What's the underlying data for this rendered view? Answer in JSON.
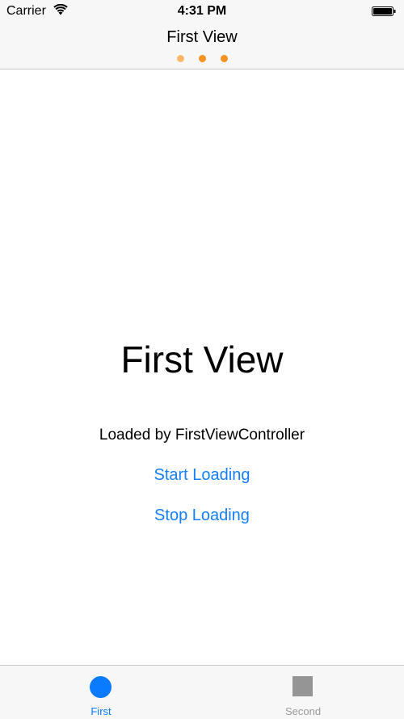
{
  "status_bar": {
    "carrier": "Carrier",
    "time": "4:31 PM",
    "wifi_icon": "wifi-icon",
    "battery_icon": "battery-icon"
  },
  "nav": {
    "title": "First View",
    "page_indicator": {
      "count": 3,
      "colors": [
        "#fbb86b",
        "#f5911e",
        "#f5911e"
      ]
    }
  },
  "main": {
    "title": "First View",
    "subtitle": "Loaded by FirstViewController",
    "start_label": "Start Loading",
    "stop_label": "Stop Loading"
  },
  "tab_bar": {
    "tabs": [
      {
        "label": "First",
        "icon": "circle-icon",
        "selected": true
      },
      {
        "label": "Second",
        "icon": "square-icon",
        "selected": false
      }
    ]
  },
  "colors": {
    "accent": "#147efb",
    "tab_selected": "#0a7aff",
    "tab_unselected": "#999999",
    "icon_unselected": "#959595"
  }
}
